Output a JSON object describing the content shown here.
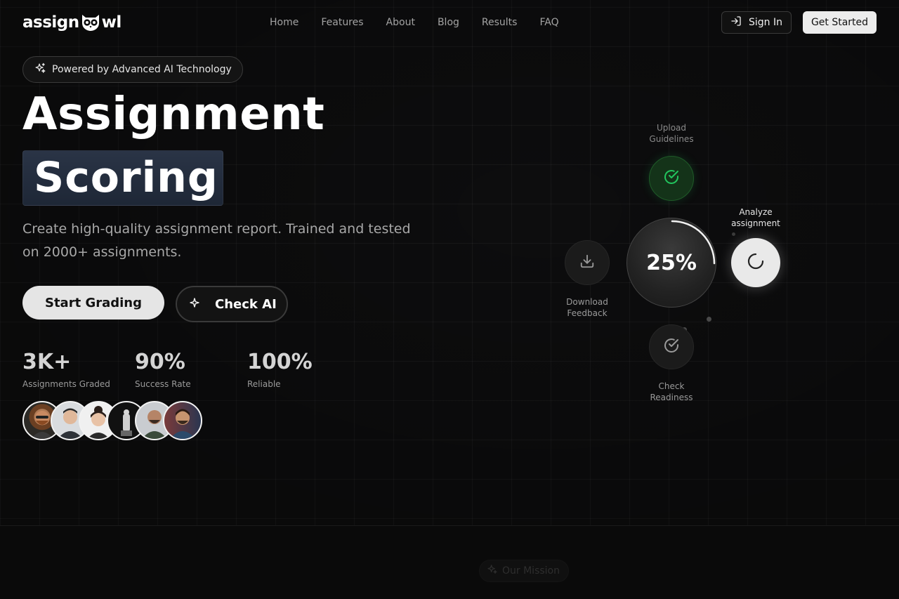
{
  "brand": {
    "logo_prefix": "assign",
    "logo_suffix": "wl"
  },
  "nav": {
    "links": [
      "Home",
      "Features",
      "About",
      "Blog",
      "Results",
      "FAQ"
    ],
    "sign_in": "Sign In",
    "get_started": "Get Started"
  },
  "hero": {
    "badge": "Powered by Advanced AI Technology",
    "title_line1": "Assignment",
    "title_line2": "Scoring",
    "subtitle": "Create high-quality assignment report. Trained and tested on 2000+ assignments.",
    "primary_cta": "Start Grading",
    "secondary_cta": "Check AI",
    "stats": [
      {
        "value": "3K+",
        "label": "Assignments Graded"
      },
      {
        "value": "90%",
        "label": "Success Rate"
      },
      {
        "value": "100%",
        "label": "Reliable"
      }
    ],
    "avatar_count": 6
  },
  "workflow": {
    "progress_label": "25%",
    "progress": 0.25,
    "steps": {
      "upload": {
        "label": "Upload Guidelines",
        "status": "complete"
      },
      "analyze": {
        "label": "Analyze assignment",
        "status": "active"
      },
      "check": {
        "label": "Check Readiness",
        "status": "pending"
      },
      "download": {
        "label": "Download Feedback",
        "status": "pending"
      }
    }
  },
  "mission_badge": "Our Mission",
  "colors": {
    "background": "#0d0d0e",
    "accent_green": "#22c55e",
    "button_light": "#e5e5e5",
    "scoring_highlight": "#26303f"
  }
}
